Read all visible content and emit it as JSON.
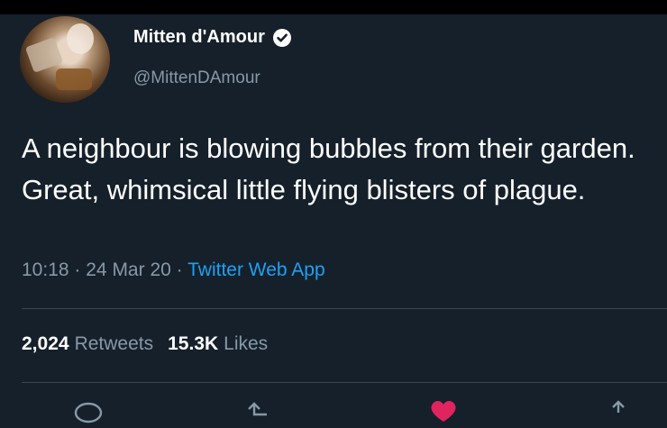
{
  "user": {
    "display_name": "Mitten d'Amour",
    "handle": "@MittenDAmour",
    "verified": true
  },
  "tweet": {
    "text": "A neighbour is blowing bubbles from their garden. Great, whimsical little flying blisters of plague.",
    "time": "10:18",
    "date": "24 Mar 20",
    "source": "Twitter Web App",
    "separator": "·"
  },
  "stats": {
    "retweets_count": "2,024",
    "retweets_label": "Retweets",
    "likes_count": "15.3K",
    "likes_label": "Likes"
  },
  "icons": [
    "reply-icon",
    "retweet-icon",
    "like-icon",
    "share-icon"
  ],
  "colors": {
    "background": "#15202b",
    "text": "#ffffff",
    "secondary": "#8899a6",
    "link": "#1da1f2",
    "like": "#e0245e"
  }
}
